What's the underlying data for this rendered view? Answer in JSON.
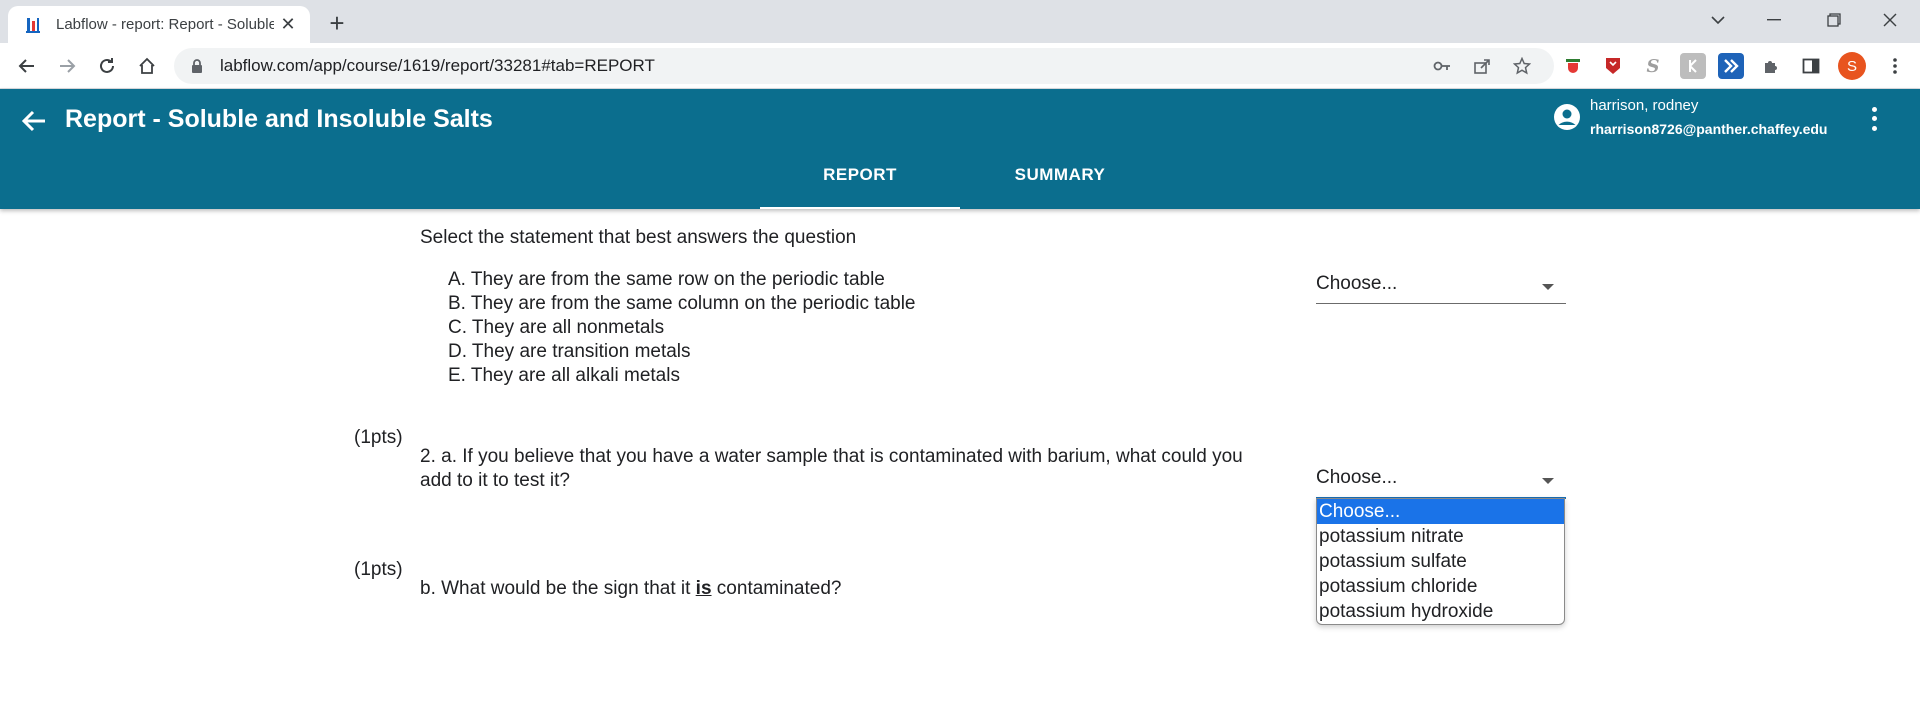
{
  "browser": {
    "tab_title": "Labflow - report: Report - Soluble",
    "tab_close": "✕",
    "new_tab": "+",
    "url": "labflow.com/app/course/1619/report/33281#tab=REPORT",
    "profile_initial": "S"
  },
  "header": {
    "title": "Report - Soluble and Insoluble Salts",
    "user_name": "harrison, rodney",
    "user_email": "rharrison8726@panther.chaffey.edu",
    "tabs": [
      {
        "label": "REPORT",
        "active": true
      },
      {
        "label": "SUMMARY",
        "active": false
      }
    ]
  },
  "question1": {
    "prompt": "Select the statement that best answers the question",
    "options": [
      "A. They are from the same row on the periodic table",
      "B. They are from the same column on the periodic table",
      "C. They are all nonmetals",
      "D. They are transition metals",
      "E. They are all alkali metals"
    ],
    "select_value": "Choose..."
  },
  "question2a": {
    "points": "(1pts)",
    "text_line1": "2. a. If you believe that you have a water sample that is contaminated with barium, what could you",
    "text_line2": "add to it to test it?",
    "select_value": "Choose...",
    "dropdown_options": [
      "Choose...",
      "potassium nitrate",
      "potassium sulfate",
      "potassium chloride",
      "potassium hydroxide"
    ]
  },
  "question2b": {
    "points": "(1pts)",
    "text_before": "b. What would be the sign that it ",
    "text_emph": "is",
    "text_after": " contaminated?"
  },
  "colors": {
    "appbar": "#0b6e8e",
    "dropdown_highlight": "#1a73e8"
  }
}
